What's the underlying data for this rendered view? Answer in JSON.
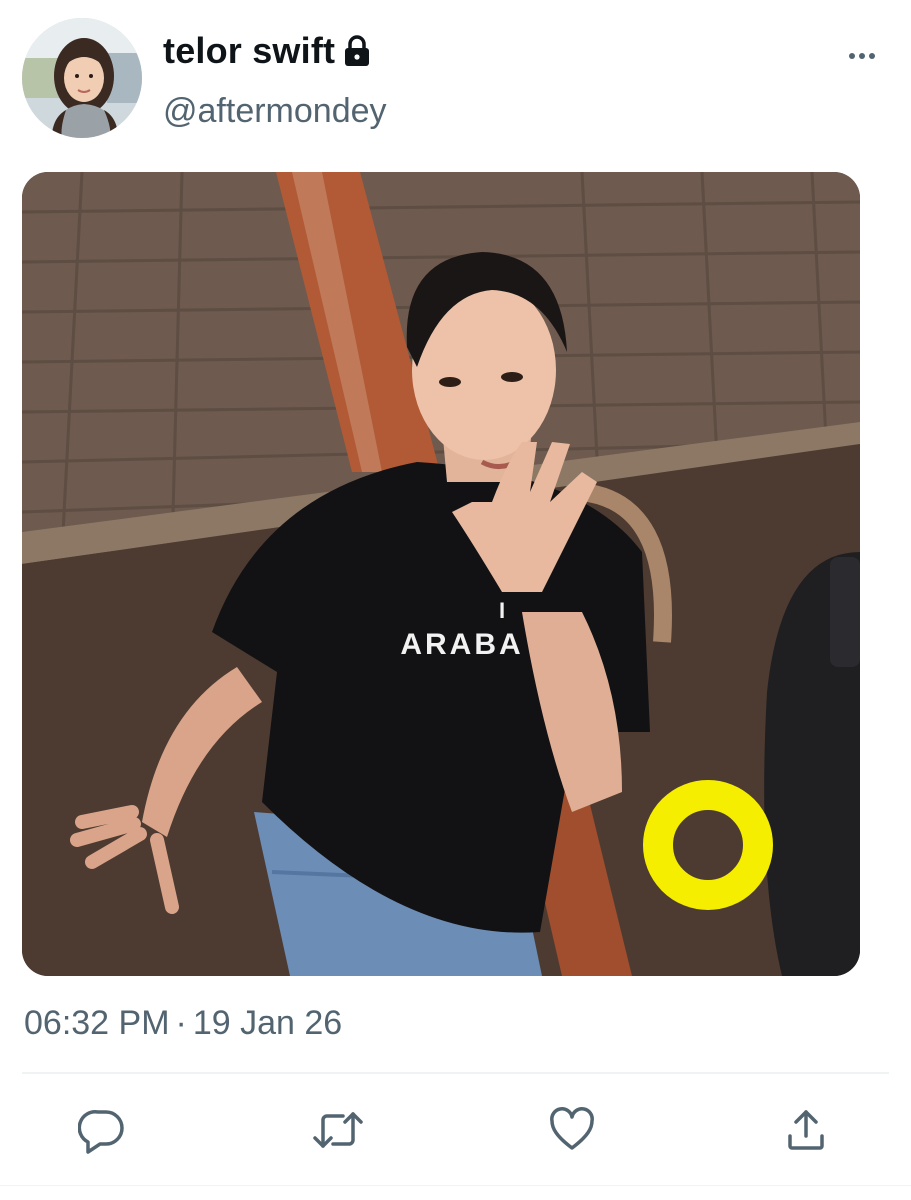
{
  "user": {
    "display_name": "telor swift",
    "handle": "@aftermondey",
    "protected_icon": "lock-icon",
    "avatar": "profile-photo"
  },
  "header": {
    "more_icon": "more-horizontal-icon"
  },
  "media": {
    "shirt_text": "ARABA",
    "shirt_text_top": "I"
  },
  "meta": {
    "time": "06:32 PM",
    "separator": "·",
    "date": "19 Jan 26"
  },
  "actions": [
    {
      "name": "reply",
      "icon": "reply-icon"
    },
    {
      "name": "retweet",
      "icon": "retweet-icon"
    },
    {
      "name": "like",
      "icon": "heart-icon"
    },
    {
      "name": "share",
      "icon": "share-icon"
    }
  ],
  "colors": {
    "text_primary": "#0f1419",
    "text_secondary": "#536471",
    "icon": "#536471",
    "divider": "#eff3f4",
    "ring_highlight": "#f5ee00"
  }
}
